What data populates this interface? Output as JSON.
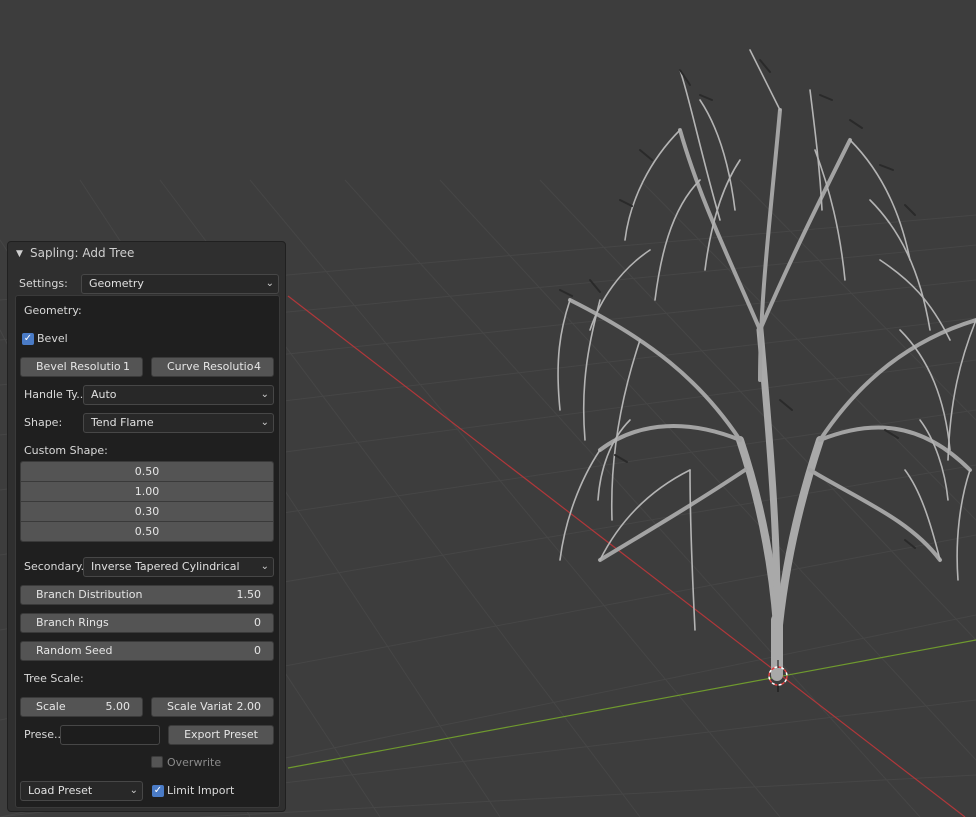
{
  "panel": {
    "title": "Sapling: Add Tree",
    "settings_label": "Settings:",
    "settings_value": "Geometry",
    "section_label": "Geometry:",
    "bevel_label": "Bevel",
    "bevel_checked": true,
    "bevel_resolution": {
      "label": "Bevel Resolutio",
      "value": "1"
    },
    "curve_resolution": {
      "label": "Curve Resolutio",
      "value": "4"
    },
    "handle_type": {
      "label": "Handle Ty...",
      "value": "Auto"
    },
    "shape": {
      "label": "Shape:",
      "value": "Tend Flame"
    },
    "custom_shape_label": "Custom Shape:",
    "custom_shape_values": [
      "0.50",
      "1.00",
      "0.30",
      "0.50"
    ],
    "secondary": {
      "label": "Secondary...",
      "value": "Inverse Tapered Cylindrical"
    },
    "branch_distribution": {
      "label": "Branch Distribution",
      "value": "1.50"
    },
    "branch_rings": {
      "label": "Branch Rings",
      "value": "0"
    },
    "random_seed": {
      "label": "Random Seed",
      "value": "0"
    },
    "tree_scale_label": "Tree Scale:",
    "scale": {
      "label": "Scale",
      "value": "5.00"
    },
    "scale_variation": {
      "label": "Scale Variat",
      "value": "2.00"
    },
    "preset_label": "Prese...",
    "preset_name_value": "",
    "export_preset_label": "Export Preset",
    "overwrite_label": "Overwrite",
    "overwrite_checked": false,
    "load_preset_label": "Load Preset",
    "limit_import_label": "Limit Import",
    "limit_import_checked": true
  },
  "colors": {
    "viewport_bg": "#3d3d3d",
    "grid_line": "#454545",
    "x_axis": "#b0373a",
    "y_axis": "#6f9a2e",
    "panel_bg": "#2f2f2f",
    "accent": "#4a7bc6",
    "tree_bark": "#a6a6a6"
  },
  "icons": {
    "collapse": "triangle-down-icon",
    "dropdown": "chevron-down-icon",
    "checkbox": "checkmark-icon",
    "origin": "3d-cursor-icon"
  }
}
